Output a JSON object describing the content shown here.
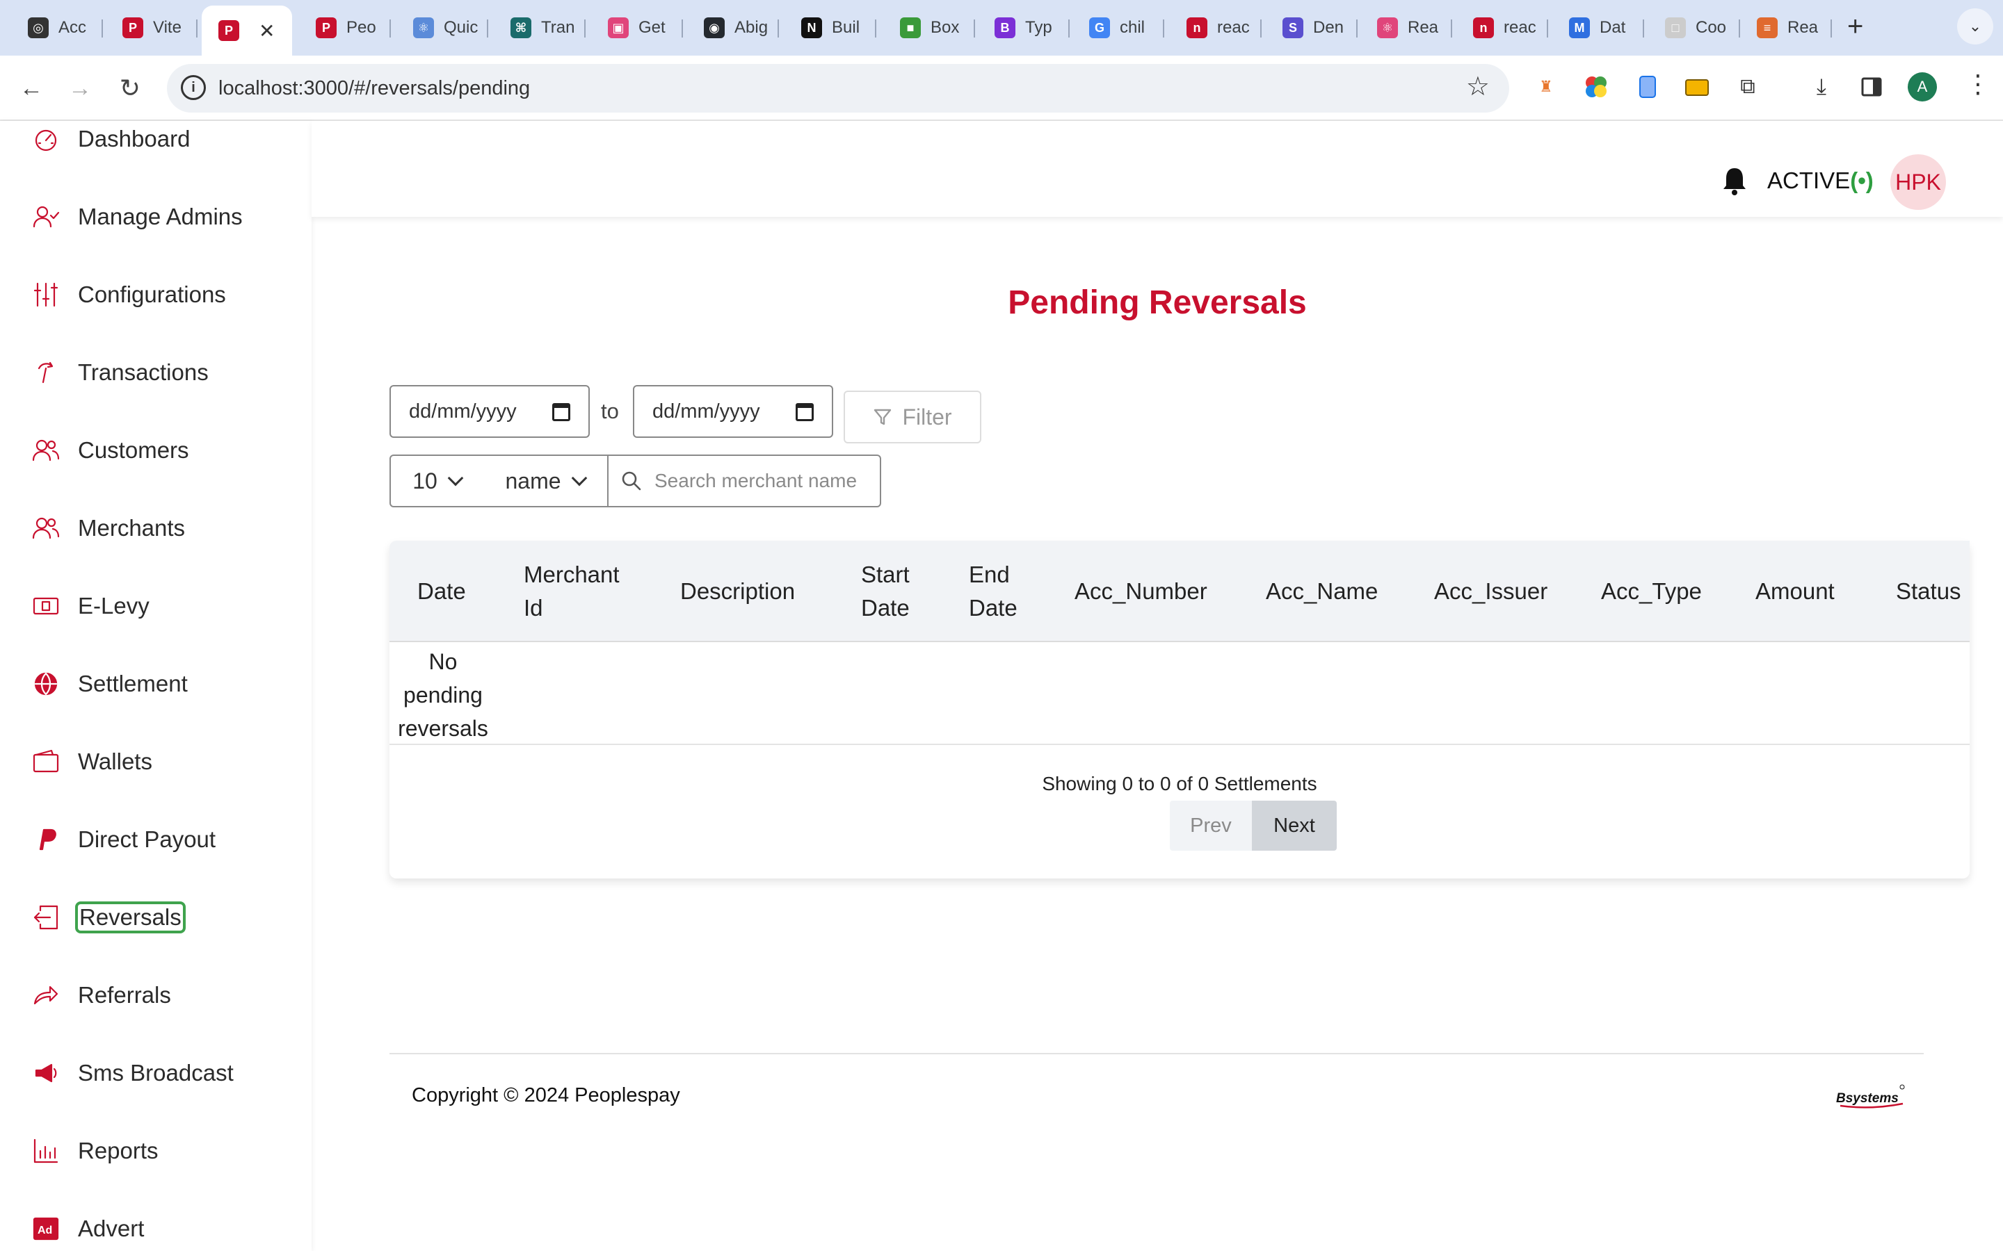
{
  "browser": {
    "tabs": [
      {
        "label": "Acc",
        "color": "#333333",
        "glyph": "◎"
      },
      {
        "label": "Vite",
        "color": "#c8102e",
        "glyph": "P"
      },
      {
        "label": "",
        "color": "#c8102e",
        "glyph": "P"
      },
      {
        "label": "Peo",
        "color": "#c8102e",
        "glyph": "P"
      },
      {
        "label": "Quic",
        "color": "#5b8bd9",
        "glyph": "⚛"
      },
      {
        "label": "Tran",
        "color": "#1a6b6b",
        "glyph": "⌘"
      },
      {
        "label": "Get",
        "color": "#e0457b",
        "glyph": "▣"
      },
      {
        "label": "Abig",
        "color": "#24292f",
        "glyph": "◉"
      },
      {
        "label": "Buil",
        "color": "#111111",
        "glyph": "N"
      },
      {
        "label": "Box",
        "color": "#3a9a3a",
        "glyph": "■"
      },
      {
        "label": "Typ",
        "color": "#7b2fd6",
        "glyph": "B"
      },
      {
        "label": "chil",
        "color": "#4285f4",
        "glyph": "G"
      },
      {
        "label": "reac",
        "color": "#c8102e",
        "glyph": "n"
      },
      {
        "label": "Den",
        "color": "#5a4fcf",
        "glyph": "S"
      },
      {
        "label": "Rea",
        "color": "#e0457b",
        "glyph": "⚛"
      },
      {
        "label": "reac",
        "color": "#c8102e",
        "glyph": "n"
      },
      {
        "label": "Dat",
        "color": "#2f6fe0",
        "glyph": "M"
      },
      {
        "label": "Coo",
        "color": "#cccccc",
        "glyph": "□"
      },
      {
        "label": "Rea",
        "color": "#e06a2f",
        "glyph": "≡"
      }
    ],
    "active_tab_index": 2,
    "url": "localhost:3000/#/reversals/pending",
    "profile_initial": "A"
  },
  "sidebar": {
    "items": [
      {
        "label": "Dashboard",
        "icon": "gauge-icon"
      },
      {
        "label": "Manage Admins",
        "icon": "user-check-icon"
      },
      {
        "label": "Configurations",
        "icon": "sliders-icon"
      },
      {
        "label": "Transactions",
        "icon": "transactions-icon"
      },
      {
        "label": "Customers",
        "icon": "users-icon"
      },
      {
        "label": "Merchants",
        "icon": "users-icon"
      },
      {
        "label": "E-Levy",
        "icon": "money-icon"
      },
      {
        "label": "Settlement",
        "icon": "globe-icon"
      },
      {
        "label": "Wallets",
        "icon": "wallet-icon"
      },
      {
        "label": "Direct Payout",
        "icon": "paypal-icon"
      },
      {
        "label": "Reversals",
        "icon": "reverse-icon"
      },
      {
        "label": "Referrals",
        "icon": "share-icon"
      },
      {
        "label": "Sms Broadcast",
        "icon": "megaphone-icon"
      },
      {
        "label": "Reports",
        "icon": "bar-chart-icon"
      },
      {
        "label": "Advert",
        "icon": "ad-icon"
      }
    ],
    "focused_item": "Reversals"
  },
  "header": {
    "status_text": "ACTIVE",
    "status_signal": "(•)",
    "avatar_initials": "HPK"
  },
  "main": {
    "title": "Pending Reversals",
    "date_from_placeholder": "dd/mm/yyyy",
    "date_to_placeholder": "dd/mm/yyyy",
    "to_label": "to",
    "filter_label": "Filter",
    "page_size": "10",
    "sort_field": "name",
    "search_placeholder": "Search merchant name",
    "table": {
      "columns": [
        "Date",
        "Merchant Id",
        "Description",
        "Start Date",
        "End Date",
        "Acc_Number",
        "Acc_Name",
        "Acc_Issuer",
        "Acc_Type",
        "Amount",
        "Status"
      ],
      "empty_message": "No pending reversals"
    },
    "pagination": {
      "summary": "Showing 0 to 0 of 0 Settlements",
      "prev_label": "Prev",
      "next_label": "Next"
    }
  },
  "footer": {
    "copyright": "Copyright © 2024 Peoplespay",
    "brand_logo_text": "Bsystems"
  },
  "colors": {
    "brand_red": "#c8102e",
    "active_green": "#2e9e40",
    "focus_outline": "#3fa34d"
  }
}
